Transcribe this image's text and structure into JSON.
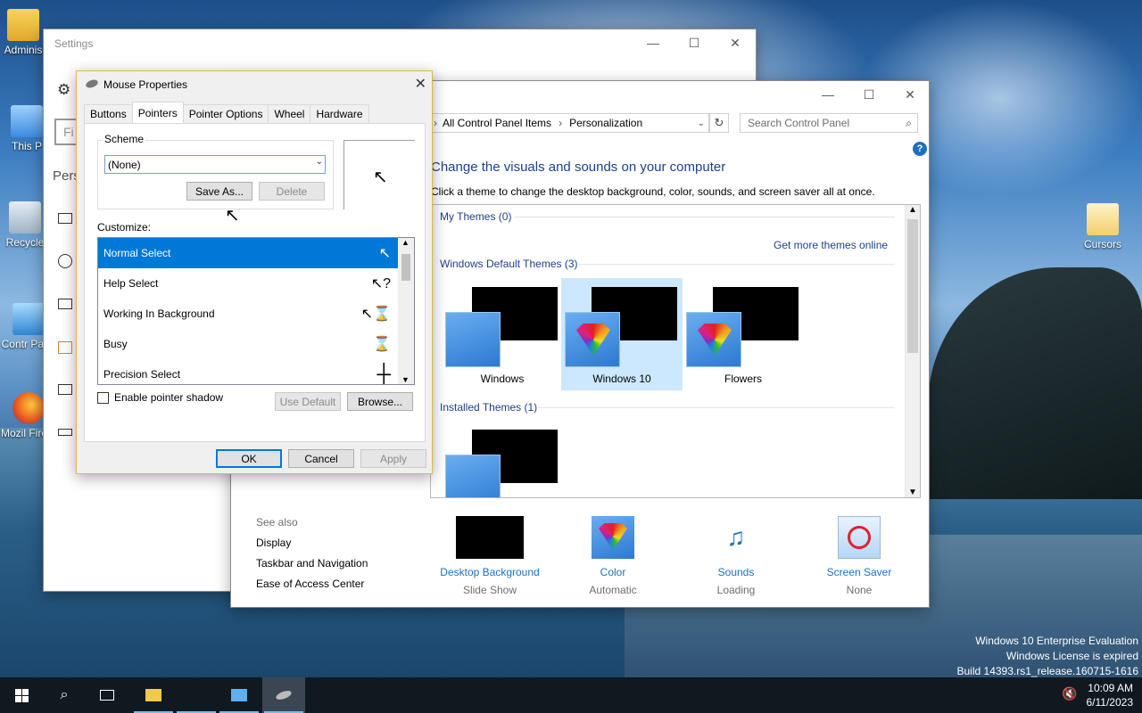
{
  "desktop": {
    "icons": [
      {
        "label": "Adminis"
      },
      {
        "label": "This P"
      },
      {
        "label": "Recycle"
      },
      {
        "label": "Contr Pane"
      },
      {
        "label": "Mozil Firefo"
      },
      {
        "label": "Cursors"
      }
    ],
    "watermark": [
      "Windows 10 Enterprise Evaluation",
      "Windows License is expired",
      "Build 14393.rs1_release.160715-1616"
    ]
  },
  "settings_window": {
    "title": "Settings",
    "sidebar_partial": "Pers",
    "search_partial": "Fi"
  },
  "control_panel": {
    "breadcrumb": [
      "All Control Panel Items",
      "Personalization"
    ],
    "search_placeholder": "Search Control Panel",
    "heading": "Change the visuals and sounds on your computer",
    "subheading": "Click a theme to change the desktop background, color, sounds, and screen saver all at once.",
    "my_themes_label": "My Themes (0)",
    "get_more": "Get more themes online",
    "default_themes_label": "Windows Default Themes (3)",
    "themes": [
      {
        "name": "Windows",
        "selected": false
      },
      {
        "name": "Windows 10",
        "selected": true
      },
      {
        "name": "Flowers",
        "selected": false
      }
    ],
    "installed_label": "Installed Themes (1)",
    "see_also": "See also",
    "links": [
      "Display",
      "Taskbar and Navigation",
      "Ease of Access Center"
    ],
    "bottom": [
      {
        "label": "Desktop Background",
        "sub": "Slide Show"
      },
      {
        "label": "Color",
        "sub": "Automatic"
      },
      {
        "label": "Sounds",
        "sub": "Loading"
      },
      {
        "label": "Screen Saver",
        "sub": "None"
      }
    ]
  },
  "mouse_properties": {
    "title": "Mouse Properties",
    "tabs": [
      "Buttons",
      "Pointers",
      "Pointer Options",
      "Wheel",
      "Hardware"
    ],
    "active_tab": "Pointers",
    "scheme_label": "Scheme",
    "scheme_value": "(None)",
    "save_as": "Save As...",
    "delete": "Delete",
    "customize_label": "Customize:",
    "pointers": [
      {
        "name": "Normal Select",
        "glyph": "arrow-cursor-icon",
        "cur": "↖",
        "selected": true
      },
      {
        "name": "Help Select",
        "glyph": "help-cursor-icon",
        "cur": "↖?",
        "selected": false
      },
      {
        "name": "Working In Background",
        "glyph": "working-cursor-icon",
        "cur": "↖⌛",
        "selected": false
      },
      {
        "name": "Busy",
        "glyph": "hourglass-cursor-icon",
        "cur": "⌛",
        "selected": false
      },
      {
        "name": "Precision Select",
        "glyph": "crosshair-cursor-icon",
        "cur": "┼",
        "selected": false
      }
    ],
    "shadow_label": "Enable pointer shadow",
    "shadow_checked": false,
    "use_default": "Use Default",
    "browse": "Browse...",
    "ok": "OK",
    "cancel": "Cancel",
    "apply": "Apply"
  },
  "taskbar": {
    "time": "10:09 AM",
    "date": "6/11/2023"
  }
}
